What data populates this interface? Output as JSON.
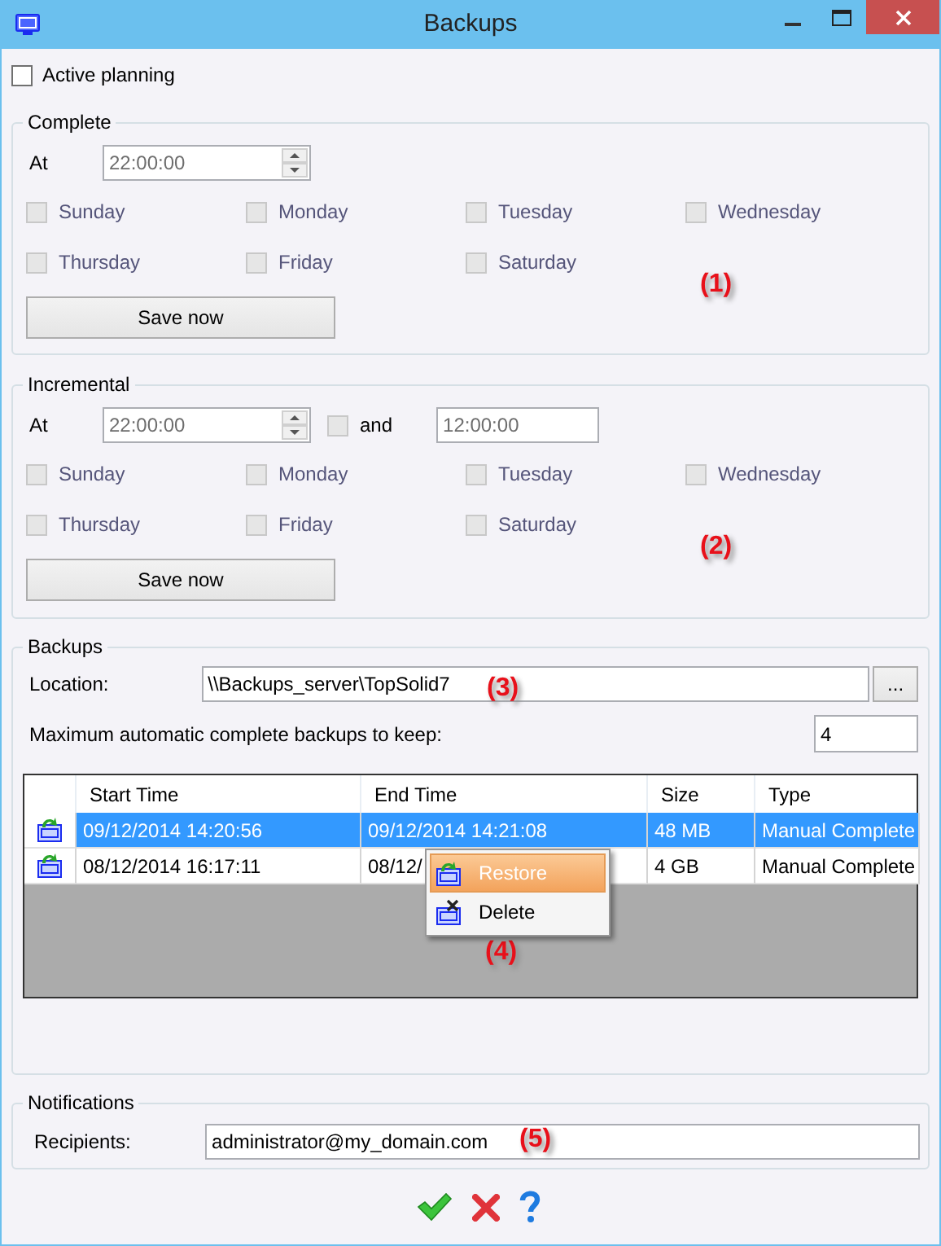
{
  "window": {
    "title": "Backups"
  },
  "active_planning": {
    "label": "Active planning",
    "checked": false
  },
  "complete": {
    "title": "Complete",
    "at_label": "At",
    "time": "22:00:00",
    "schedule_disabled": true,
    "days": [
      {
        "label": "Sunday",
        "checked": false
      },
      {
        "label": "Monday",
        "checked": false
      },
      {
        "label": "Tuesday",
        "checked": false
      },
      {
        "label": "Wednesday",
        "checked": false
      },
      {
        "label": "Thursday",
        "checked": false
      },
      {
        "label": "Friday",
        "checked": false
      },
      {
        "label": "Saturday",
        "checked": false
      }
    ],
    "save_button": "Save now",
    "callout": "(1)"
  },
  "incremental": {
    "title": "Incremental",
    "at_label": "At",
    "time": "22:00:00",
    "schedule_disabled": true,
    "and_label": "and",
    "and_checked": false,
    "second_time": "12:00:00",
    "days": [
      {
        "label": "Sunday",
        "checked": false
      },
      {
        "label": "Monday",
        "checked": false
      },
      {
        "label": "Tuesday",
        "checked": false
      },
      {
        "label": "Wednesday",
        "checked": false
      },
      {
        "label": "Thursday",
        "checked": false
      },
      {
        "label": "Friday",
        "checked": false
      },
      {
        "label": "Saturday",
        "checked": false
      }
    ],
    "save_button": "Save now",
    "callout": "(2)"
  },
  "backups": {
    "title": "Backups",
    "location_label": "Location:",
    "location": "\\\\Backups_server\\TopSolid7",
    "browse_button": "...",
    "callout": "(3)",
    "max_label": "Maximum automatic complete backups to keep:",
    "max_value": "4",
    "table": {
      "columns": [
        "Start Time",
        "End Time",
        "Size",
        "Type"
      ],
      "rows": [
        {
          "selected": true,
          "cells": [
            "09/12/2014 14:20:56",
            "09/12/2014 14:21:08",
            "48 MB",
            "Manual Complete"
          ]
        },
        {
          "selected": false,
          "cells": [
            "08/12/2014 16:17:11",
            "08/12/",
            "4 GB",
            "Manual Complete"
          ]
        }
      ],
      "callout": "(4)"
    },
    "context_menu": [
      {
        "kind": "restore",
        "label": "Restore",
        "selected": true
      },
      {
        "kind": "delete",
        "label": "Delete",
        "selected": false
      }
    ]
  },
  "notifications": {
    "title": "Notifications",
    "recipients_label": "Recipients:",
    "recipients": "administrator@my_domain.com",
    "callout": "(5)"
  }
}
